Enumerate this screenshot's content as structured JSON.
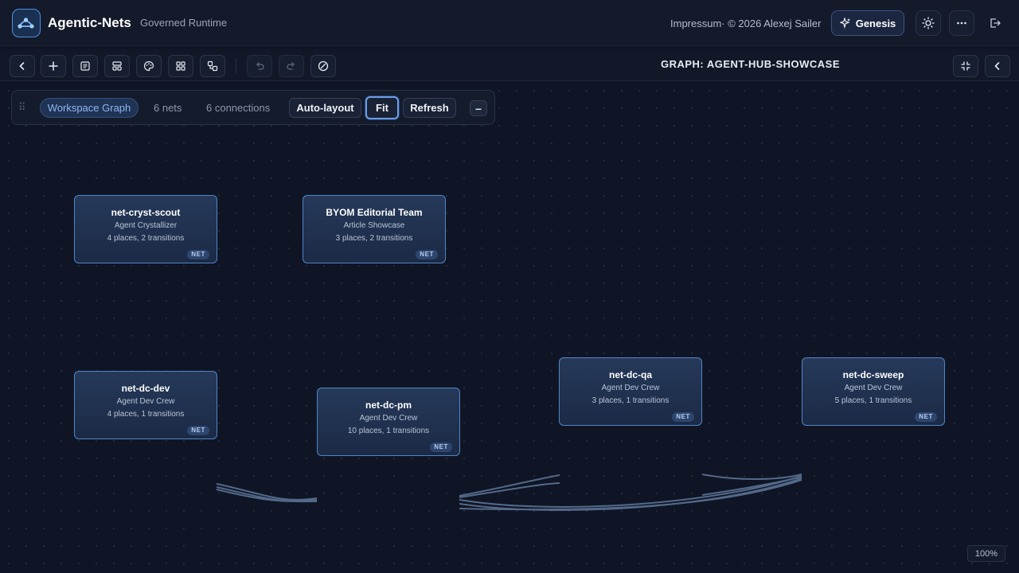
{
  "header": {
    "app_title": "Agentic-Nets",
    "app_subtitle": "Governed Runtime",
    "impressum": "Impressum· © 2026 Alexej Sailer",
    "genesis_label": "Genesis"
  },
  "toolbar": {
    "graph_title": "GRAPH: AGENT-HUB-SHOWCASE"
  },
  "panel": {
    "active_label": "Workspace Graph",
    "nets_count": "6 nets",
    "connections_count": "6 connections",
    "autolayout_label": "Auto-layout",
    "fit_label": "Fit",
    "refresh_label": "Refresh",
    "collapse_label": "–"
  },
  "nodes": [
    {
      "name": "net-cryst-scout",
      "subtitle": "Agent Crystallizer",
      "stats": "4 places, 2 transitions",
      "badge": "NET"
    },
    {
      "name": "BYOM Editorial Team",
      "subtitle": "Article Showcase",
      "stats": "3 places, 2 transitions",
      "badge": "NET"
    },
    {
      "name": "net-dc-dev",
      "subtitle": "Agent Dev Crew",
      "stats": "4 places, 1 transitions",
      "badge": "NET"
    },
    {
      "name": "net-dc-pm",
      "subtitle": "Agent Dev Crew",
      "stats": "10 places, 1 transitions",
      "badge": "NET"
    },
    {
      "name": "net-dc-qa",
      "subtitle": "Agent Dev Crew",
      "stats": "3 places, 1 transitions",
      "badge": "NET"
    },
    {
      "name": "net-dc-sweep",
      "subtitle": "Agent Dev Crew",
      "stats": "5 places, 1 transitions",
      "badge": "NET"
    }
  ],
  "zoom": "100%",
  "colors": {
    "accent": "#4f85c8",
    "background": "#0f1524",
    "edge": "#6a85ad"
  }
}
